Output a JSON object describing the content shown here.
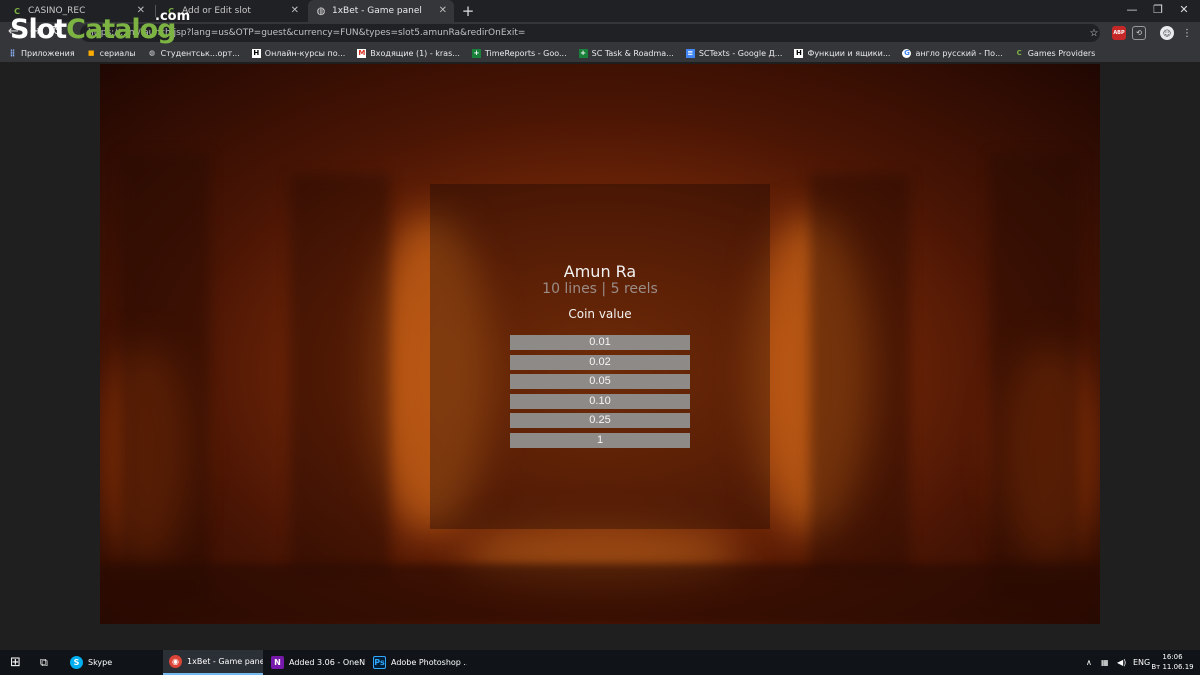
{
  "browser": {
    "tabs": [
      {
        "label": "CASINO_REC",
        "favicon": "C",
        "active": false
      },
      {
        "label": "Add or Edit slot",
        "favicon": "C",
        "active": false
      },
      {
        "label": "1xBet - Game panel",
        "favicon": "globe-icon",
        "active": true
      }
    ],
    "url": "https://...m/launch.jsp?lang=us&OTP=guest&currency=FUN&types=slot5.amunRa&redirOnExit=",
    "bookmarks": [
      {
        "label": "Приложения",
        "icon": "apps-icon"
      },
      {
        "label": "сериалы",
        "icon": "folder-icon"
      },
      {
        "label": "Студентськ...орт...",
        "icon": "globe-icon"
      },
      {
        "label": "Онлайн-курсы по...",
        "icon": "page-icon"
      },
      {
        "label": "Входящие (1) - kras...",
        "icon": "gmail-icon"
      },
      {
        "label": "TimeReports - Goo...",
        "icon": "sheets-icon"
      },
      {
        "label": "SC Task & Roadma...",
        "icon": "sheets-icon"
      },
      {
        "label": "SCTexts - Google Д...",
        "icon": "docs-icon"
      },
      {
        "label": "Функции и ящики...",
        "icon": "page-icon"
      },
      {
        "label": "англо русский - По...",
        "icon": "google-icon"
      },
      {
        "label": "Games Providers",
        "icon": "C"
      }
    ]
  },
  "watermark": {
    "slot": "Slot",
    "catalog": "Catalog",
    "com": ".com"
  },
  "game": {
    "title": "Amun Ra",
    "subtitle": "10 lines  |  5 reels",
    "coin_label": "Coin value",
    "coin_values": [
      "0.01",
      "0.02",
      "0.05",
      "0.10",
      "0.25",
      "1"
    ]
  },
  "taskbar": {
    "items": [
      {
        "label": "Skype",
        "icon": "skype-icon"
      },
      {
        "label": "1xBet - Game panel...",
        "icon": "chrome-icon"
      },
      {
        "label": "Added 3.06 - OneN...",
        "icon": "onenote-icon"
      },
      {
        "label": "Adobe Photoshop ...",
        "icon": "photoshop-icon"
      }
    ],
    "lang": "ENG",
    "time": "16:06",
    "date": "Вт 11.06.19"
  }
}
